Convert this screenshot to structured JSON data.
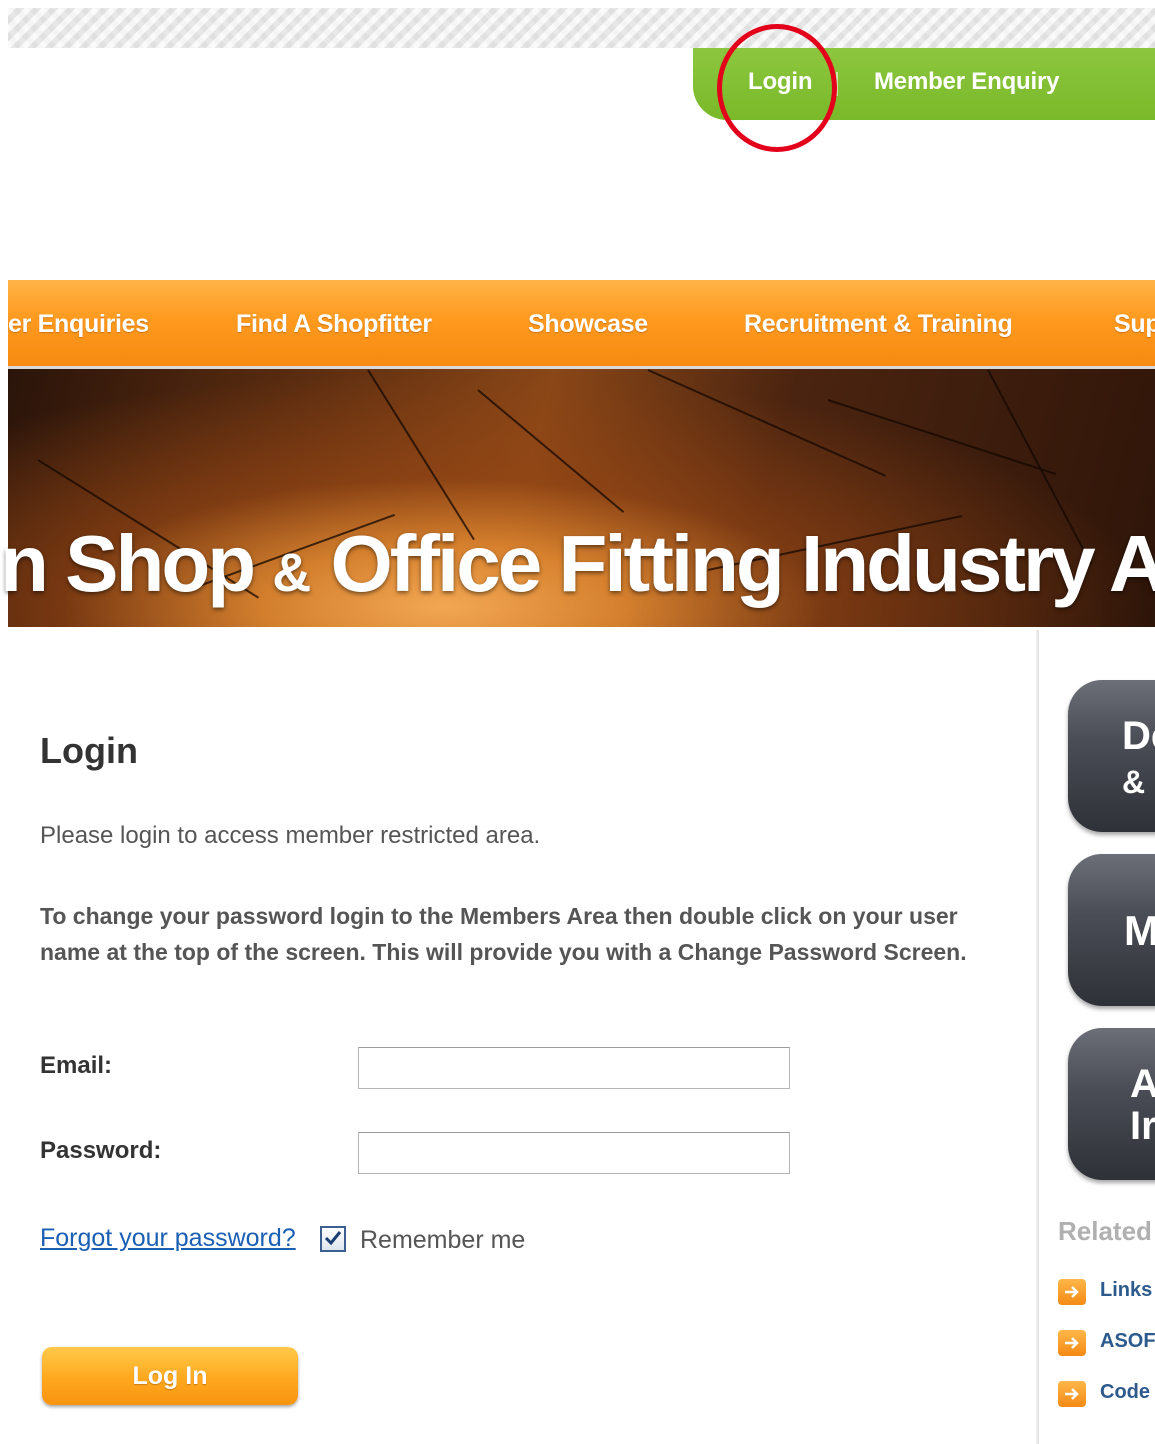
{
  "utility_nav": {
    "login": "Login",
    "member_enquiry": "Member Enquiry"
  },
  "main_nav": {
    "items": [
      "er Enquiries",
      "Find A Shopfitter",
      "Showcase",
      "Recruitment & Training",
      "Sup"
    ]
  },
  "banner": {
    "title_pre": "n Shop ",
    "title_amp": "&",
    "title_post": " Office Fitting Industry Ass"
  },
  "login_form": {
    "heading": "Login",
    "intro": "Please login to access member restricted area.",
    "instructions": "To change your password login to the Members Area then double click on your user name at the top of the screen.  This will provide you with a Change Password Screen.",
    "email_label": "Email:",
    "email_value": "",
    "password_label": "Password:",
    "password_value": "",
    "forgot_link": "Forgot your password?",
    "remember_label": "Remember me",
    "remember_checked": true,
    "submit_label": "Log In"
  },
  "sidebar": {
    "tiles": [
      {
        "line1": "De",
        "line2": "& I"
      },
      {
        "line1": "M",
        "line2": ""
      },
      {
        "line1": "A",
        "line2": "Ir"
      }
    ],
    "related_heading": "Related",
    "related_links": [
      "Links",
      "ASOF",
      "Code"
    ]
  },
  "colors": {
    "utility_green": "#8cc63f",
    "nav_orange": "#ff9a1f",
    "link_blue": "#1a5fb4",
    "highlight_red": "#e3001b",
    "tile_dark": "#3a3d44"
  }
}
